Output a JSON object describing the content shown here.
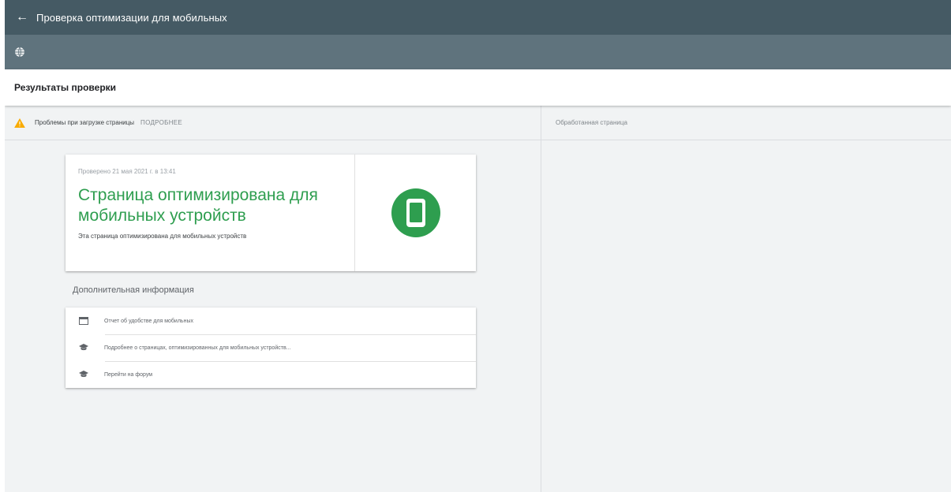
{
  "appbar": {
    "title": "Проверка оптимизации для мобильных"
  },
  "subbar": {
    "icon": "globe-icon"
  },
  "results": {
    "heading": "Результаты проверки"
  },
  "status": {
    "warning_text": "Проблемы при загрузке страницы",
    "more_link": "ПОДРОБНЕЕ"
  },
  "rendered_page": {
    "label": "Обработанная страница"
  },
  "result_card": {
    "checked_date": "Проверено 21 мая 2021 г. в 13:41",
    "headline": "Страница оптимизирована для мобильных устройств",
    "description": "Эта страница оптимизирована для мобильных устройств",
    "badge_color": "#2e9e4f"
  },
  "additional_info": {
    "title": "Дополнительная информация",
    "items": [
      {
        "icon": "report-icon",
        "label": "Отчет об удобстве для мобильных"
      },
      {
        "icon": "graduation-cap-icon",
        "label": "Подробнее о страницах, оптимизированных для мобильных устройств..."
      },
      {
        "icon": "graduation-cap-icon",
        "label": "Перейти на форум"
      }
    ]
  },
  "colors": {
    "appbar": "#455a64",
    "subbar": "#5f737d",
    "accent_green": "#2e9e4f",
    "warning": "#f9ab00"
  }
}
